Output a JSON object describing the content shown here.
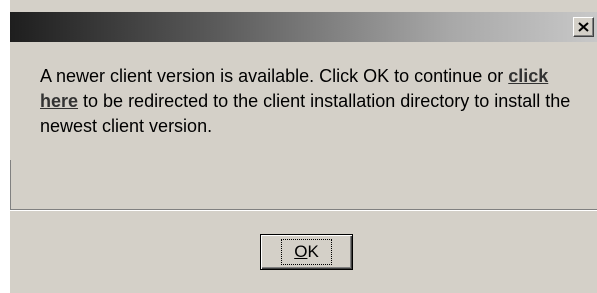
{
  "dialog": {
    "title": "",
    "close_icon": "close-icon",
    "message": {
      "part1": "A newer client version is available. Click OK to continue or ",
      "link_text": "click here",
      "part2": " to be redirected to the client installation directory to install the newest client version."
    },
    "ok_button": {
      "accelerator": "O",
      "rest": "K"
    }
  },
  "colors": {
    "dialog_background": "#d4d0c8",
    "title_bar_dark": "#1e1e1e",
    "title_bar_light": "#c8c8c8",
    "link_color": "#333333"
  }
}
